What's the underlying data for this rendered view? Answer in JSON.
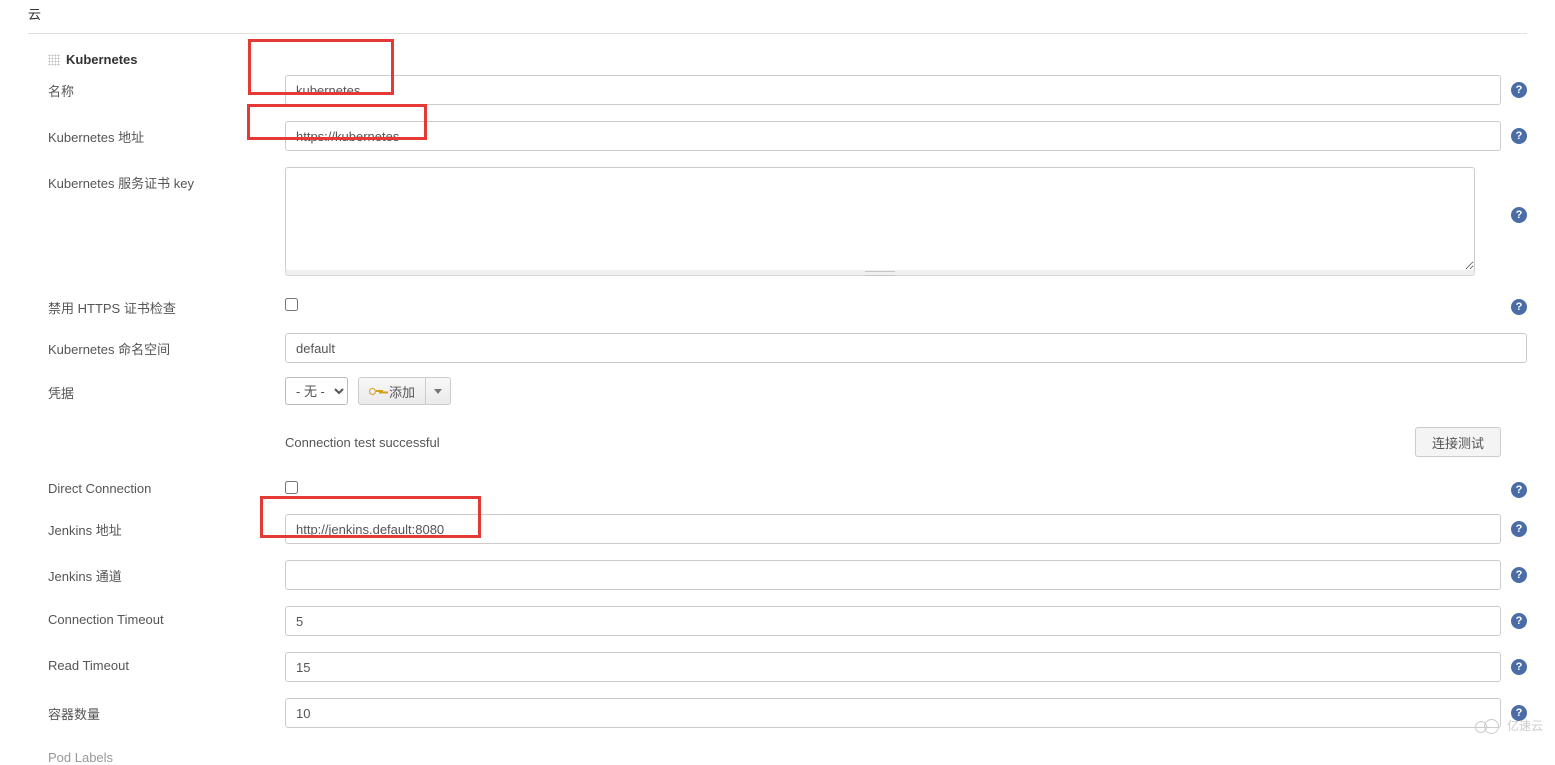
{
  "section": {
    "title": "云"
  },
  "block": {
    "title": "Kubernetes"
  },
  "fields": {
    "name": {
      "label": "名称",
      "value": "kubernetes"
    },
    "k8s_url": {
      "label": "Kubernetes 地址",
      "value": "https://kubernetes"
    },
    "server_cert_key": {
      "label": "Kubernetes 服务证书 key",
      "value": ""
    },
    "disable_https_check": {
      "label": "禁用 HTTPS 证书检查"
    },
    "namespace": {
      "label": "Kubernetes 命名空间",
      "value": "default"
    },
    "credentials": {
      "label": "凭据",
      "selected": "- 无 -",
      "add_label": "添加"
    },
    "connection_status": "Connection test successful",
    "test_button": "连接测试",
    "direct_connection": {
      "label": "Direct Connection"
    },
    "jenkins_url": {
      "label": "Jenkins 地址",
      "value": "http://jenkins.default:8080"
    },
    "jenkins_tunnel": {
      "label": "Jenkins 通道",
      "value": ""
    },
    "connection_timeout": {
      "label": "Connection Timeout",
      "value": "5"
    },
    "read_timeout": {
      "label": "Read Timeout",
      "value": "15"
    },
    "container_cap": {
      "label": "容器数量",
      "value": "10"
    },
    "pod_labels": {
      "label": "Pod Labels"
    }
  },
  "watermark": "亿速云"
}
